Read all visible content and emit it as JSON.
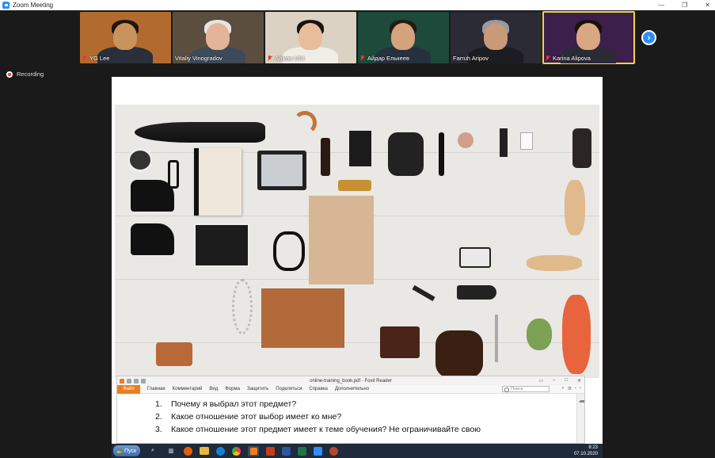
{
  "window": {
    "title": "Zoom Meeting",
    "controls": [
      "—",
      "❐",
      "✕"
    ]
  },
  "participants": [
    {
      "name": "YG Lee",
      "muted": true,
      "bg": "#b36a2e",
      "skin": "#c9935e",
      "hair": "#1d1512",
      "shirt": "#2a2f3a",
      "active": false
    },
    {
      "name": "Vitaliy Vinogradov",
      "muted": false,
      "bg": "#5b4e3f",
      "skin": "#e2b49a",
      "hair": "#e8e4df",
      "shirt": "#3c4a5a",
      "active": false
    },
    {
      "name": "Айжан UNI",
      "muted": true,
      "bg": "#dcd2c4",
      "skin": "#e8bd9c",
      "hair": "#1c120e",
      "shirt": "#f0ece6",
      "active": false
    },
    {
      "name": "Айдар Елькеев",
      "muted": true,
      "bg": "#1d4a3a",
      "skin": "#d4a27c",
      "hair": "#241a14",
      "shirt": "#26313e",
      "active": false
    },
    {
      "name": "Farruh Aripov",
      "muted": false,
      "bg": "#2a2b35",
      "skin": "#c99a78",
      "hair": "#999a9e",
      "shirt": "#1c1c22",
      "active": false
    },
    {
      "name": "Karina Alipova",
      "muted": true,
      "bg": "#3c1f4a",
      "skin": "#d9a781",
      "hair": "#1a100c",
      "shirt": "#2b2b35",
      "active": true
    }
  ],
  "recording": {
    "label": "Recording"
  },
  "pdf": {
    "title": "online-training_book.pdf - Foxit Reader",
    "ribbon": [
      "Файл",
      "Главная",
      "Комментарий",
      "Вид",
      "Форма",
      "Защитить",
      "Поделиться",
      "Справка",
      "Дополнительно"
    ],
    "search_placeholder": "Поиск",
    "questions": [
      {
        "num": "1.",
        "text": "Почему я выбрал этот предмет?"
      },
      {
        "num": "2.",
        "text": "Какое отношение этот выбор имеет ко мне?"
      },
      {
        "num": "3.",
        "text": "Какое отношение этот предмет имеет к теме обучения? Не ограничивайте свою"
      }
    ]
  },
  "taskbar": {
    "start_label": "Пуск",
    "time": "8:23",
    "date": "07.10.2020"
  },
  "colors": {
    "zoom_blue": "#2d8cff",
    "active_speaker": "#f2d24e",
    "foxit_orange": "#f07d1a",
    "muted_red": "#e33333"
  }
}
